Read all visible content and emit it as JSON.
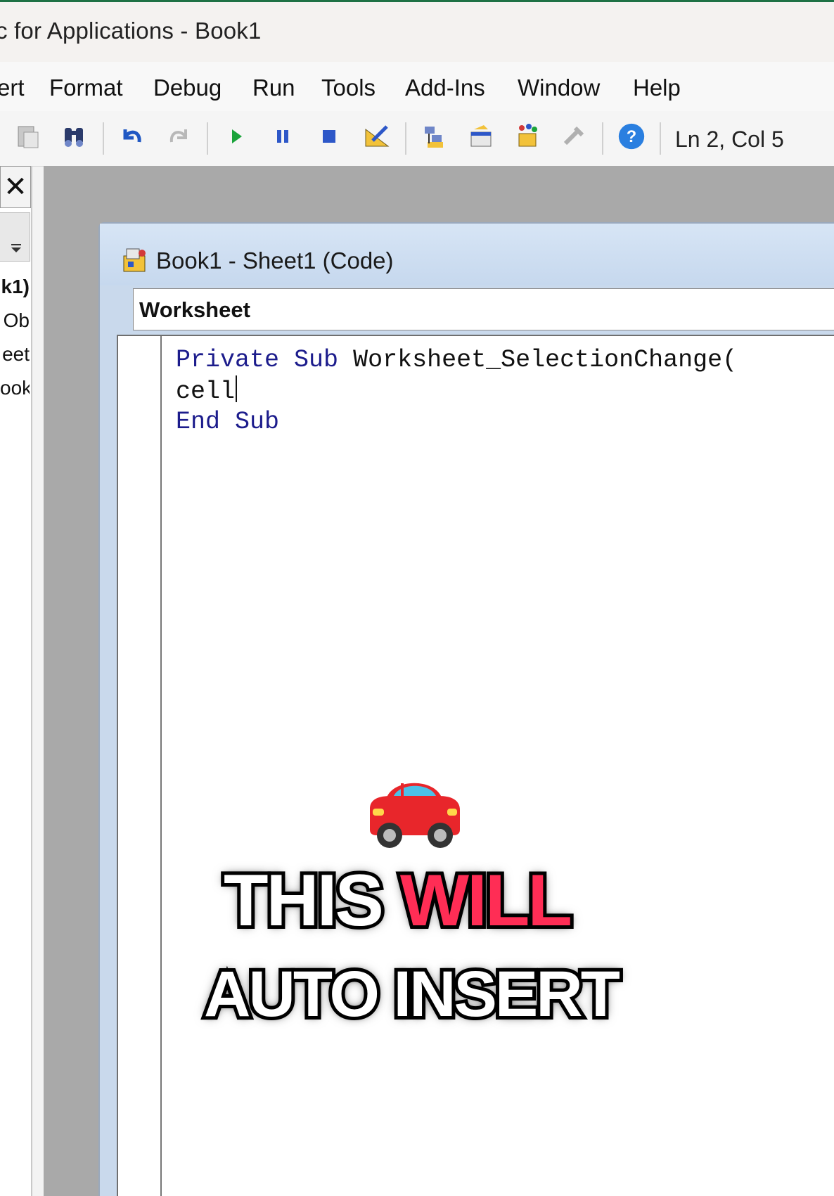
{
  "window": {
    "title": "c for Applications - Book1"
  },
  "menu": {
    "items": [
      "ert",
      "Format",
      "Debug",
      "Run",
      "Tools",
      "Add-Ins",
      "Window",
      "Help"
    ]
  },
  "toolbar": {
    "icons": [
      "paste-icon",
      "find-icon",
      "undo-icon",
      "redo-icon",
      "run-icon",
      "break-icon",
      "reset-icon",
      "design-mode-icon",
      "project-explorer-icon",
      "properties-icon",
      "object-browser-icon",
      "toolbox-icon",
      "help-icon"
    ],
    "status": "Ln 2, Col 5"
  },
  "project_panel": {
    "close_glyph": "✕",
    "tree_fragments": [
      "k1)",
      "Ob",
      "eet",
      "ook"
    ]
  },
  "code_window": {
    "title": "Book1 - Sheet1 (Code)",
    "object_combo": "Worksheet",
    "lines": [
      {
        "kw1": "Private",
        "kw2": "Sub",
        "rest": "Worksheet_SelectionChange("
      },
      {
        "text": "cell"
      },
      {
        "kw1": "End",
        "kw2": "Sub"
      }
    ]
  },
  "overlay": {
    "emoji": "car-emoji",
    "caption_line1_a": "THIS",
    "caption_line1_b": "WILL",
    "caption_line2": "AUTO INSERT",
    "highlight_color": "#ff2d55"
  }
}
